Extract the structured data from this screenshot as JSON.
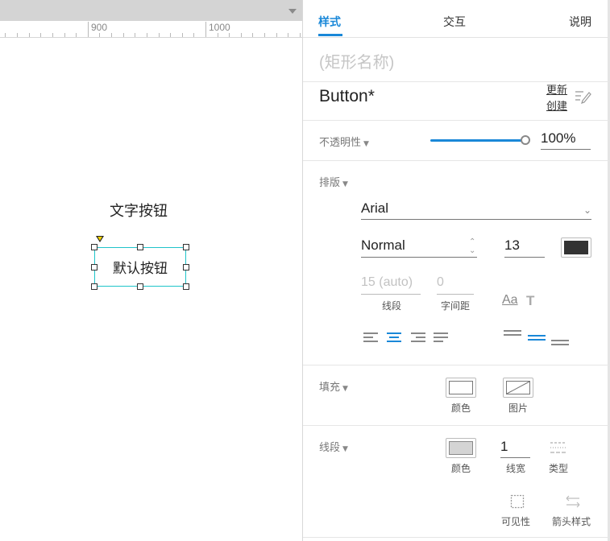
{
  "ruler": {
    "labels": [
      "900",
      "1000"
    ]
  },
  "canvas": {
    "text_button": "文字按钮",
    "default_button": "默认按钮"
  },
  "panel": {
    "tabs": {
      "style": "样式",
      "interactions": "交互",
      "notes": "说明"
    },
    "shape_name_placeholder": "(矩形名称)",
    "style_name": "Button*",
    "update_label": "更新",
    "create_label": "创建",
    "opacity": {
      "label": "不透明性",
      "value": "100%",
      "level": 1.0
    },
    "typography": {
      "label": "排版",
      "font_family": "Arial",
      "font_weight": "Normal",
      "font_size": "13",
      "font_color": "#333333",
      "line_spacing": "15 (auto)",
      "line_spacing_label": "线段",
      "char_spacing": "0",
      "char_spacing_label": "字间距",
      "text_style_icon_text": "Aa",
      "text_shadow_icon_text": "T",
      "align_active": "center",
      "valign_active": "middle"
    },
    "fill": {
      "label": "填充",
      "color_label": "颜色",
      "image_label": "图片"
    },
    "border": {
      "label": "线段",
      "color_label": "颜色",
      "width": "1",
      "width_label": "线宽",
      "type_label": "类型",
      "visibility_label": "可见性",
      "arrow_label": "箭头样式"
    },
    "accent_color": "#1a88d8"
  }
}
